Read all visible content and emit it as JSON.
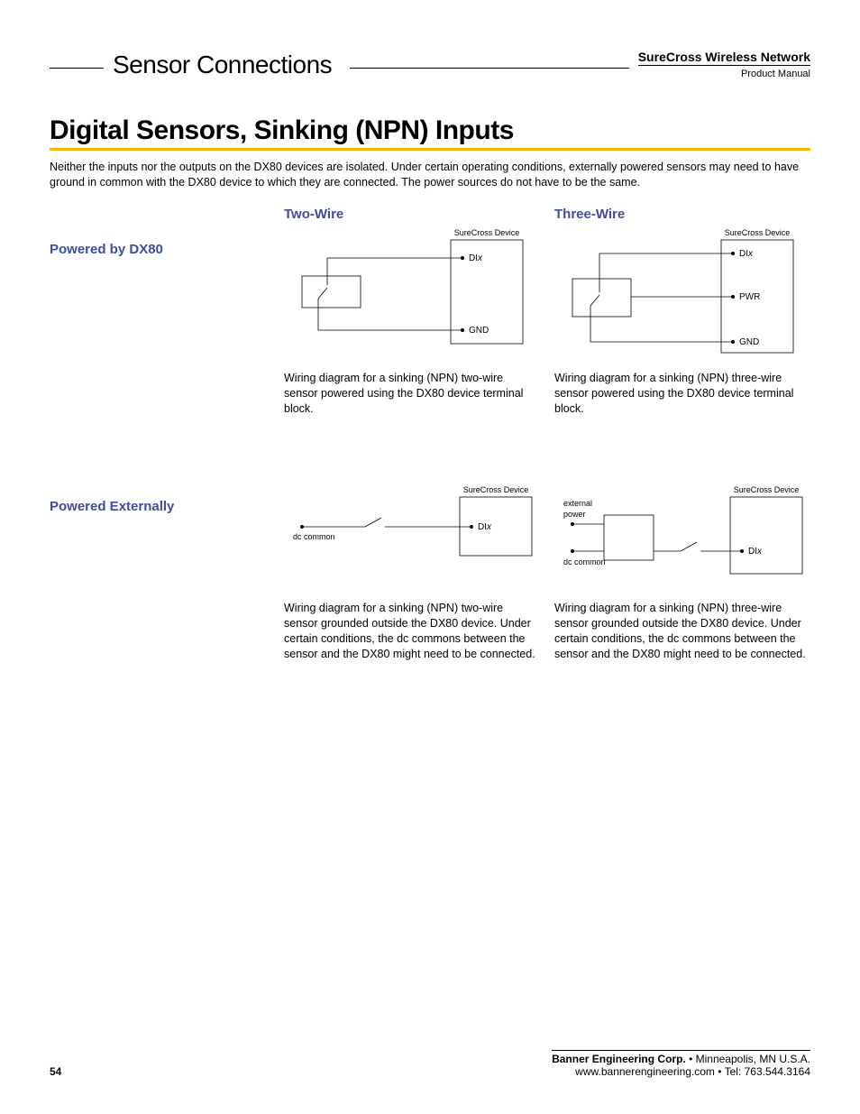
{
  "header": {
    "section": "Sensor Connections",
    "product_line": "SureCross Wireless Network",
    "doc_type": "Product Manual"
  },
  "title": "Digital Sensors, Sinking (NPN) Inputs",
  "intro": "Neither the inputs nor the outputs on the DX80 devices are isolated. Under certain operating conditions, externally powered sensors may need to have ground in common with the DX80 device to which they are connected. The power sources do not have to be the same.",
  "col_headings": {
    "two": "Two-Wire",
    "three": "Three-Wire"
  },
  "side_headings": {
    "dx80": "Powered by DX80",
    "ext": "Powered Externally"
  },
  "labels": {
    "device": "SureCross Device",
    "dix_pre": "DI",
    "dix_suf": "x",
    "pwr": "PWR",
    "gnd": "GND",
    "dc_common": "dc common",
    "ext_power_1": "external",
    "ext_power_2": "power"
  },
  "captions": {
    "a": "Wiring diagram for a sinking (NPN) two-wire sensor powered using the DX80 device terminal block.",
    "b": "Wiring diagram for a sinking (NPN) three-wire sensor powered using the DX80 device terminal block.",
    "c": "Wiring diagram for a sinking (NPN) two-wire sensor grounded outside the DX80 device. Under certain conditions, the dc commons between the sensor and the DX80 might need to be connected.",
    "d": "Wiring diagram for a sinking (NPN) three-wire sensor grounded outside the DX80 device. Under certain conditions, the dc commons between the sensor and the DX80 might need to be connected."
  },
  "footer": {
    "page": "54",
    "company": "Banner Engineering Corp.",
    "location": " •  Minneapolis, MN U.S.A.",
    "contact": "www.bannerengineering.com  •  Tel: 763.544.3164"
  }
}
